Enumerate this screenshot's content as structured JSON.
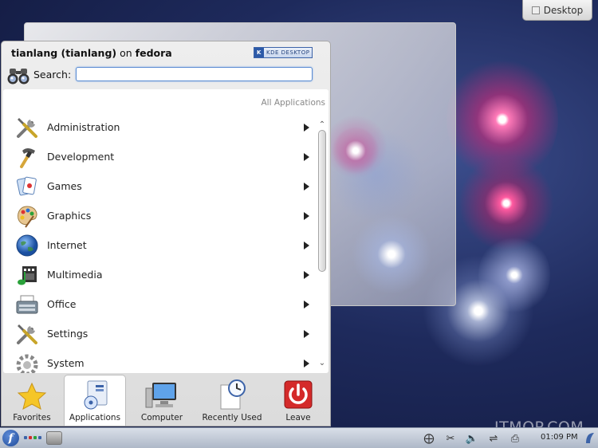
{
  "desktop": {
    "toolbox_label": "Desktop"
  },
  "kickoff": {
    "user_name": "tianlang (tianlang)",
    "user_on": "on",
    "host": "fedora",
    "logo_text": "KDE DESKTOP",
    "search_label": "Search:",
    "search_value": "",
    "breadcrumb": "All Applications",
    "items": [
      {
        "label": "Administration",
        "icon": "administration-icon"
      },
      {
        "label": "Development",
        "icon": "development-icon"
      },
      {
        "label": "Games",
        "icon": "games-icon"
      },
      {
        "label": "Graphics",
        "icon": "graphics-icon"
      },
      {
        "label": "Internet",
        "icon": "internet-icon"
      },
      {
        "label": "Multimedia",
        "icon": "multimedia-icon"
      },
      {
        "label": "Office",
        "icon": "office-icon"
      },
      {
        "label": "Settings",
        "icon": "settings-icon"
      },
      {
        "label": "System",
        "icon": "system-icon"
      }
    ],
    "tabs": [
      {
        "label": "Favorites",
        "icon": "star-icon",
        "active": false
      },
      {
        "label": "Applications",
        "icon": "applications-icon",
        "active": true
      },
      {
        "label": "Computer",
        "icon": "computer-icon",
        "active": false
      },
      {
        "label": "Recently Used",
        "icon": "clock-icon",
        "active": false
      },
      {
        "label": "Leave",
        "icon": "power-icon",
        "active": false
      }
    ]
  },
  "taskbar": {
    "launcher_glyph": "f",
    "clock": "01:09 PM"
  },
  "watermark": "ITMOP.COM",
  "colors": {
    "accent": "#5a8bd1",
    "leave_red": "#d42a2a",
    "desktop_bg": "#1e2a5c"
  }
}
